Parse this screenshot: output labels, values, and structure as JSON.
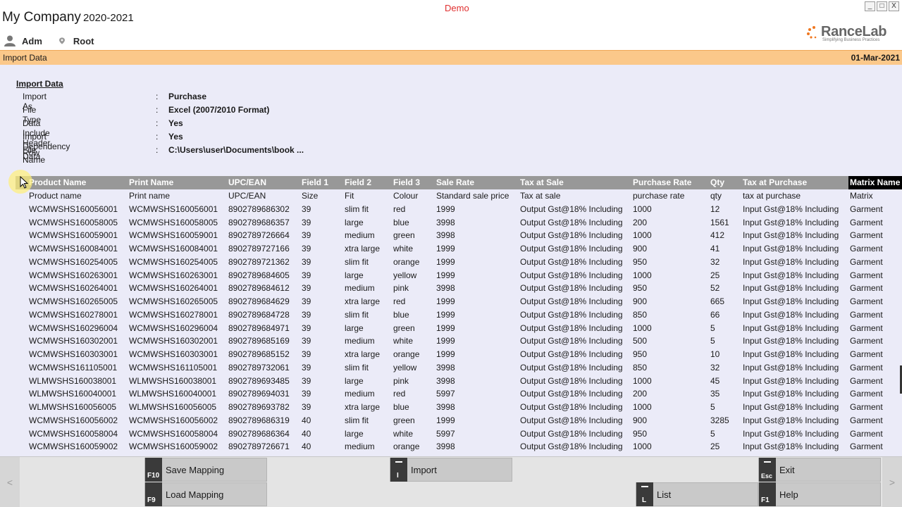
{
  "window": {
    "company": "My Company",
    "year": "2020-2021",
    "mode": "Demo",
    "controls": [
      "_",
      "□",
      "X"
    ]
  },
  "user": {
    "name": "Adm",
    "location": "Root",
    "user_icon": "user-icon",
    "location_icon": "map-pin-icon"
  },
  "brand": {
    "name": "RanceLab",
    "tagline": "Simplifying Business Practices",
    "accent": "#f07820"
  },
  "titlebar": {
    "title": "Import Data",
    "date": "01-Mar-2021",
    "color": "#fbc88a"
  },
  "import_info": {
    "section_title": "Import Data",
    "separator": ":",
    "rows": [
      {
        "label": "Import As",
        "value": "Purchase"
      },
      {
        "label": "File Type",
        "value": "Excel (2007/2010 Format)"
      },
      {
        "label": "Data Include Header Row",
        "value": "Yes"
      },
      {
        "label": "Import Dependency Data",
        "value": "Yes"
      },
      {
        "label": "File Name",
        "value": "C:\\Users\\user\\Documents\\book    ..."
      }
    ]
  },
  "grid": {
    "columns": [
      "Product Name",
      "Print Name",
      "UPC/EAN",
      "Field 1",
      "Field 2",
      "Field 3",
      "Sale Rate",
      "Tax at Sale",
      "Purchase Rate",
      "Qty",
      "Tax at Purchase",
      "Matrix Name"
    ],
    "selected_column": "Matrix Name",
    "mapping": [
      "Product name",
      "Print name",
      "UPC/EAN",
      "Size",
      "Fit",
      "Colour",
      "Standard sale price",
      "Tax at sale",
      "purchase rate",
      "qty",
      "tax at purchase",
      "Matrix"
    ],
    "rows": [
      [
        "WCMWSHS160056001",
        "WCMWSHS160056001",
        "8902789686302",
        "39",
        "slim fit",
        "red",
        "1999",
        "Output Gst@18% Including",
        "1000",
        "12",
        "Input Gst@18% Including",
        "Garment"
      ],
      [
        "WCMWSHS160058005",
        "WCMWSHS160058005",
        "8902789686357",
        "39",
        "large",
        "blue",
        "3998",
        "Output Gst@18% Including",
        "200",
        "1561",
        "Input Gst@18% Including",
        "Garment"
      ],
      [
        "WCMWSHS160059001",
        "WCMWSHS160059001",
        "8902789726664",
        "39",
        "medium",
        "green",
        "3998",
        "Output Gst@18% Including",
        "1000",
        "412",
        "Input Gst@18% Including",
        "Garment"
      ],
      [
        "WCMWSHS160084001",
        "WCMWSHS160084001",
        "8902789727166",
        "39",
        "xtra large",
        "white",
        "1999",
        "Output Gst@18% Including",
        "900",
        "41",
        "Input Gst@18% Including",
        "Garment"
      ],
      [
        "WCMWSHS160254005",
        "WCMWSHS160254005",
        "8902789721362",
        "39",
        "slim fit",
        "orange",
        "1999",
        "Output Gst@18% Including",
        "950",
        "32",
        "Input Gst@18% Including",
        "Garment"
      ],
      [
        "WCMWSHS160263001",
        "WCMWSHS160263001",
        "8902789684605",
        "39",
        "large",
        "yellow",
        "1999",
        "Output Gst@18% Including",
        "1000",
        "25",
        "Input Gst@18% Including",
        "Garment"
      ],
      [
        "WCMWSHS160264001",
        "WCMWSHS160264001",
        "8902789684612",
        "39",
        "medium",
        "pink",
        "3998",
        "Output Gst@18% Including",
        "950",
        "52",
        "Input Gst@18% Including",
        "Garment"
      ],
      [
        "WCMWSHS160265005",
        "WCMWSHS160265005",
        "8902789684629",
        "39",
        "xtra large",
        "red",
        "1999",
        "Output Gst@18% Including",
        "900",
        "665",
        "Input Gst@18% Including",
        "Garment"
      ],
      [
        "WCMWSHS160278001",
        "WCMWSHS160278001",
        "8902789684728",
        "39",
        "slim fit",
        "blue",
        "1999",
        "Output Gst@18% Including",
        "850",
        "66",
        "Input Gst@18% Including",
        "Garment"
      ],
      [
        "WCMWSHS160296004",
        "WCMWSHS160296004",
        "8902789684971",
        "39",
        "large",
        "green",
        "1999",
        "Output Gst@18% Including",
        "1000",
        "5",
        "Input Gst@18% Including",
        "Garment"
      ],
      [
        "WCMWSHS160302001",
        "WCMWSHS160302001",
        "8902789685169",
        "39",
        "medium",
        "white",
        "1999",
        "Output Gst@18% Including",
        "500",
        "5",
        "Input Gst@18% Including",
        "Garment"
      ],
      [
        "WCMWSHS160303001",
        "WCMWSHS160303001",
        "8902789685152",
        "39",
        "xtra large",
        "orange",
        "1999",
        "Output Gst@18% Including",
        "950",
        "10",
        "Input Gst@18% Including",
        "Garment"
      ],
      [
        "WCMWSHS161105001",
        "WCMWSHS161105001",
        "8902789732061",
        "39",
        "slim fit",
        "yellow",
        "3998",
        "Output Gst@18% Including",
        "850",
        "32",
        "Input Gst@18% Including",
        "Garment"
      ],
      [
        "WLMWSHS160038001",
        "WLMWSHS160038001",
        "8902789693485",
        "39",
        "large",
        "pink",
        "3998",
        "Output Gst@18% Including",
        "1000",
        "45",
        "Input Gst@18% Including",
        "Garment"
      ],
      [
        "WLMWSHS160040001",
        "WLMWSHS160040001",
        "8902789694031",
        "39",
        "medium",
        "red",
        "5997",
        "Output Gst@18% Including",
        "200",
        "35",
        "Input Gst@18% Including",
        "Garment"
      ],
      [
        "WLMWSHS160056005",
        "WLMWSHS160056005",
        "8902789693782",
        "39",
        "xtra large",
        "blue",
        "3998",
        "Output Gst@18% Including",
        "1000",
        "5",
        "Input Gst@18% Including",
        "Garment"
      ],
      [
        "WCMWSHS160056002",
        "WCMWSHS160056002",
        "8902789686319",
        "40",
        "slim fit",
        "green",
        "1999",
        "Output Gst@18% Including",
        "900",
        "3285",
        "Input Gst@18% Including",
        "Garment"
      ],
      [
        "WCMWSHS160058004",
        "WCMWSHS160058004",
        "8902789686364",
        "40",
        "large",
        "white",
        "5997",
        "Output Gst@18% Including",
        "950",
        "5",
        "Input Gst@18% Including",
        "Garment"
      ],
      [
        "WCMWSHS160059002",
        "WCMWSHS160059002",
        "8902789726671",
        "40",
        "medium",
        "orange",
        "3998",
        "Output Gst@18% Including",
        "1000",
        "25",
        "Input Gst@18% Including",
        "Garment"
      ]
    ]
  },
  "footer": {
    "nav_prev": "<",
    "nav_next": ">",
    "buttons": {
      "save_mapping": {
        "key": "F10",
        "label": "Save Mapping"
      },
      "load_mapping": {
        "key": "F9",
        "label": "Load Mapping"
      },
      "import": {
        "key": "I",
        "label": "Import"
      },
      "list": {
        "key": "L",
        "label": "List"
      },
      "exit": {
        "key": "Esc",
        "label": "Exit"
      },
      "help": {
        "key": "F1",
        "label": "Help"
      }
    }
  }
}
